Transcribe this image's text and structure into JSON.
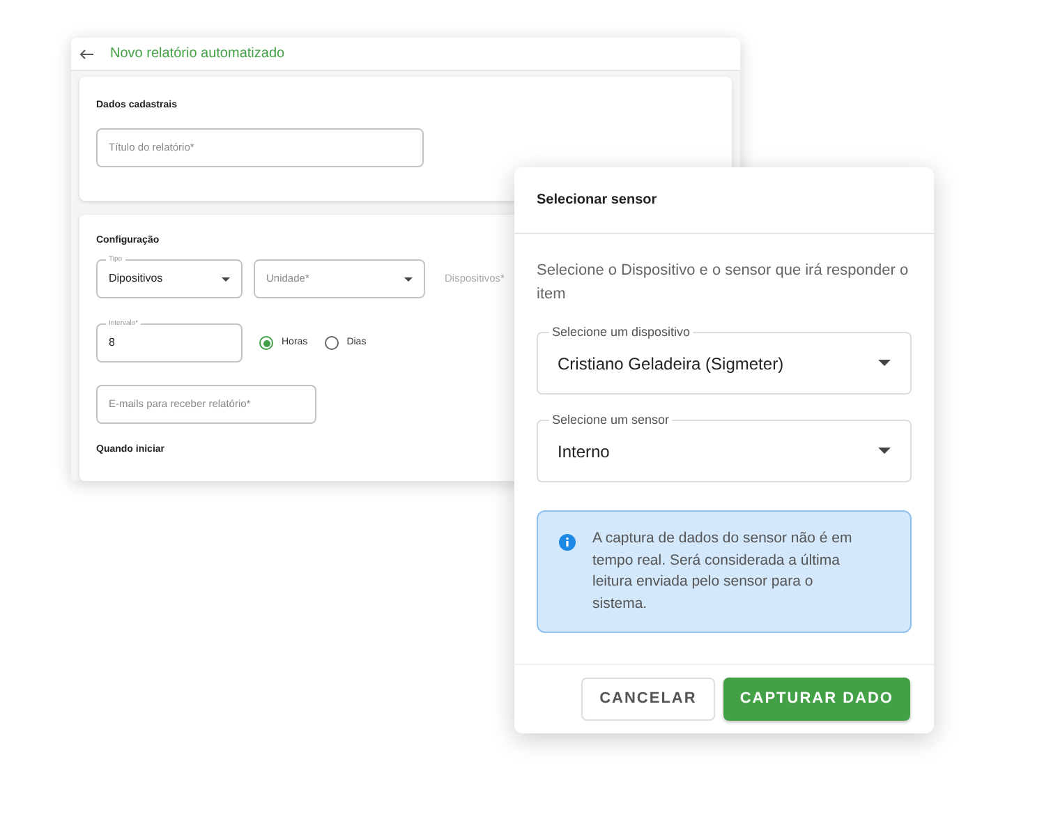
{
  "back_window": {
    "title": "Novo relatório automatizado",
    "sections": [
      {
        "title": "Dados cadastrais"
      },
      {
        "title": "Configuração"
      }
    ],
    "title_field": {
      "placeholder": "Título do relatório*"
    },
    "tipo_field": {
      "label": "Tipo",
      "value": "Dipositivos"
    },
    "unidade_field": {
      "placeholder": "Unidade*"
    },
    "dispositivos_field": {
      "placeholder": "Dispositivos*"
    },
    "intervalo_field": {
      "label": "Intervalo*",
      "value": "8"
    },
    "interval_units": [
      {
        "label": "Horas",
        "selected": true
      },
      {
        "label": "Dias",
        "selected": false
      }
    ],
    "emails_field": {
      "placeholder": "E-mails para receber relatório*"
    },
    "start_heading": "Quando iniciar"
  },
  "dialog": {
    "title": "Selecionar sensor",
    "description": "Selecione o Dispositivo e o sensor que irá responder o item",
    "selects": [
      {
        "label": "Selecione um dispositivo",
        "value": "Cristiano Geladeira (Sigmeter)"
      },
      {
        "label": "Selecione um sensor",
        "value": "Interno"
      }
    ],
    "info": "A captura de dados do sensor não é em tempo real. Será considerada a última leitura enviada pelo sensor para o sistema.",
    "buttons": [
      {
        "label": "CANCELAR",
        "kind": "secondary"
      },
      {
        "label": "CAPTURAR DADO",
        "kind": "primary"
      }
    ]
  }
}
